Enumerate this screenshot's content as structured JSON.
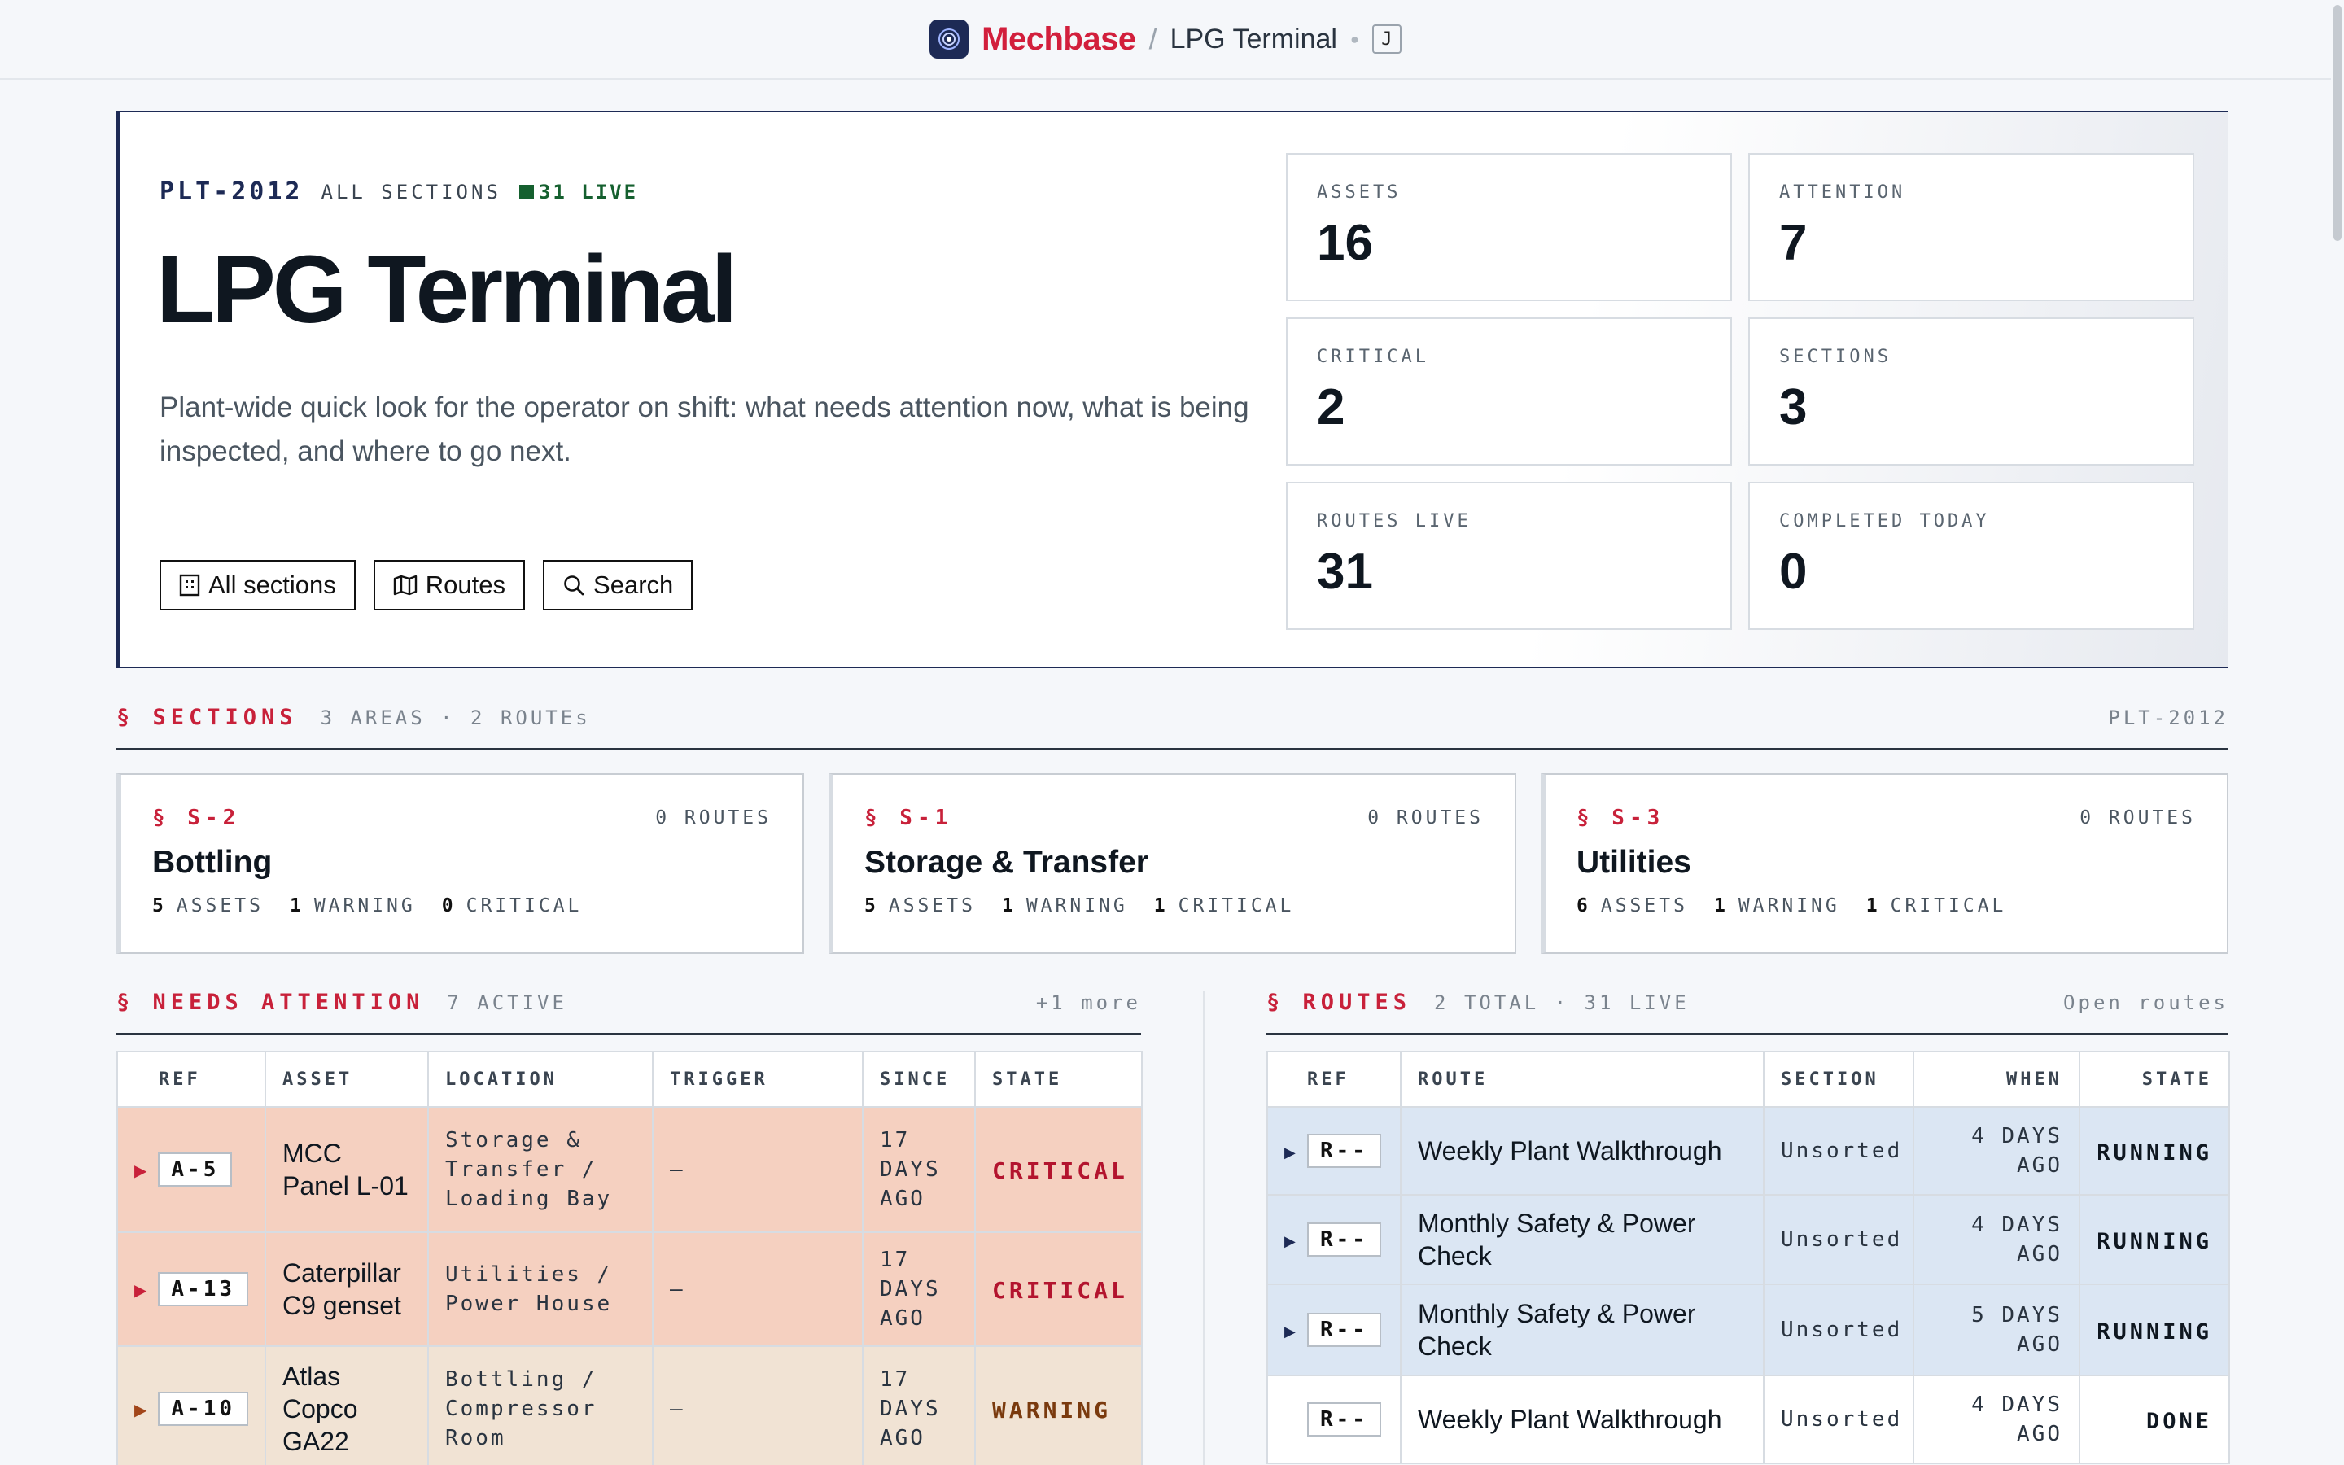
{
  "topbar": {
    "brand": "Mechbase",
    "separator": "/",
    "plant": "LPG Terminal",
    "user_initial": "J"
  },
  "hero": {
    "plant_code": "PLT-2012",
    "scope": "ALL SECTIONS",
    "live": "31 LIVE",
    "title": "LPG Terminal",
    "description": "Plant-wide quick look for the operator on shift: what needs attention now, what is being inspected, and where to go next.",
    "buttons": [
      {
        "label": "All sections",
        "icon": "grid-icon"
      },
      {
        "label": "Routes",
        "icon": "map-icon"
      },
      {
        "label": "Search",
        "icon": "search-icon"
      }
    ],
    "stats": [
      {
        "label": "ASSETS",
        "value": "16"
      },
      {
        "label": "ATTENTION",
        "value": "7"
      },
      {
        "label": "CRITICAL",
        "value": "2"
      },
      {
        "label": "SECTIONS",
        "value": "3"
      },
      {
        "label": "ROUTES LIVE",
        "value": "31"
      },
      {
        "label": "COMPLETED TODAY",
        "value": "0"
      }
    ]
  },
  "sections": {
    "title": "§ SECTIONS",
    "subtitle": "3 AREAS · 2 ROUTEs",
    "right": "PLT-2012",
    "cards": [
      {
        "code": "§ S-2",
        "routes": "0 ROUTES",
        "name": "Bottling",
        "assets": "5",
        "assets_lbl": "ASSETS",
        "warning": "1",
        "warning_lbl": "WARNING",
        "critical": "0",
        "critical_lbl": "CRITICAL"
      },
      {
        "code": "§ S-1",
        "routes": "0 ROUTES",
        "name": "Storage & Transfer",
        "assets": "5",
        "assets_lbl": "ASSETS",
        "warning": "1",
        "warning_lbl": "WARNING",
        "critical": "1",
        "critical_lbl": "CRITICAL"
      },
      {
        "code": "§ S-3",
        "routes": "0 ROUTES",
        "name": "Utilities",
        "assets": "6",
        "assets_lbl": "ASSETS",
        "warning": "1",
        "warning_lbl": "WARNING",
        "critical": "1",
        "critical_lbl": "CRITICAL"
      }
    ]
  },
  "attention": {
    "title": "§ NEEDS ATTENTION",
    "subtitle": "7 ACTIVE",
    "more": "+1 more",
    "columns": [
      "REF",
      "ASSET",
      "LOCATION",
      "TRIGGER",
      "SINCE",
      "STATE"
    ],
    "rows": [
      {
        "ref": "A-5",
        "asset": "MCC Panel L-01",
        "location": "Storage & Transfer / Loading Bay",
        "trigger": "–",
        "since": "17 DAYS AGO",
        "state": "CRITICAL"
      },
      {
        "ref": "A-13",
        "asset": "Caterpillar C9 genset",
        "location": "Utilities / Power House",
        "trigger": "–",
        "since": "17 DAYS AGO",
        "state": "CRITICAL"
      },
      {
        "ref": "A-10",
        "asset": "Atlas Copco GA22",
        "location": "Bottling / Compressor Room",
        "trigger": "–",
        "since": "17 DAYS AGO",
        "state": "WARNING"
      }
    ]
  },
  "routes": {
    "title": "§ ROUTES",
    "subtitle": "2 TOTAL · 31 LIVE",
    "right": "Open routes",
    "columns": [
      "REF",
      "ROUTE",
      "SECTION",
      "WHEN",
      "STATE"
    ],
    "rows": [
      {
        "ref": "R--",
        "route": "Weekly Plant Walkthrough",
        "section": "Unsorted",
        "when": "4 DAYS AGO",
        "state": "RUNNING"
      },
      {
        "ref": "R--",
        "route": "Monthly Safety & Power Check",
        "section": "Unsorted",
        "when": "4 DAYS AGO",
        "state": "RUNNING"
      },
      {
        "ref": "R--",
        "route": "Monthly Safety & Power Check",
        "section": "Unsorted",
        "when": "5 DAYS AGO",
        "state": "RUNNING"
      },
      {
        "ref": "R--",
        "route": "Weekly Plant Walkthrough",
        "section": "Unsorted",
        "when": "4 DAYS AGO",
        "state": "DONE"
      }
    ]
  },
  "colors": {
    "brand": "#d21f3c",
    "navy": "#1d2a55",
    "critical_row": "#f5d0c0",
    "warning_row": "#f1e3d4",
    "running_row": "#dbe6f3"
  }
}
